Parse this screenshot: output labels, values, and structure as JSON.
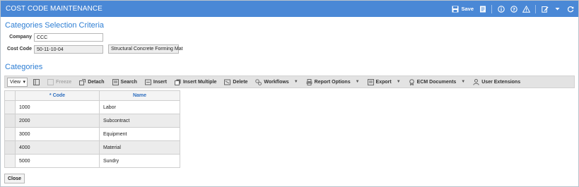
{
  "window": {
    "title": "COST CODE MAINTENANCE"
  },
  "titlebar": {
    "save_label": "Save",
    "icons": [
      "save-icon",
      "notes-icon",
      "info-icon",
      "help-icon",
      "warning-icon",
      "edit-icon",
      "refresh-icon"
    ]
  },
  "criteria": {
    "heading": "Categories Selection Criteria",
    "company_label": "Company",
    "company_value": "CCC",
    "cost_code_label": "Cost Code",
    "cost_code_value": "50-11-10-04",
    "cost_code_desc": "Structural Concrete Forming Mat"
  },
  "categories": {
    "heading": "Categories",
    "toolbar": {
      "view": "View",
      "freeze": "Freeze",
      "detach": "Detach",
      "search": "Search",
      "insert": "Insert",
      "insert_multiple": "Insert Multiple",
      "delete": "Delete",
      "workflows": "Workflows",
      "report_options": "Report Options",
      "export": "Export",
      "ecm_documents": "ECM Documents",
      "user_extensions": "User Extensions"
    },
    "columns": {
      "code": "* Code",
      "name": "Name"
    },
    "rows": [
      {
        "code": "1000",
        "name": "Labor"
      },
      {
        "code": "2000",
        "name": "Subcontract"
      },
      {
        "code": "3000",
        "name": "Equipment"
      },
      {
        "code": "4000",
        "name": "Material"
      },
      {
        "code": "5000",
        "name": "Sundry"
      }
    ]
  },
  "footer": {
    "close_label": "Close"
  },
  "colors": {
    "titlebar": "#4a88d6",
    "heading": "#2f7fd4",
    "column_header": "#2f6fbf"
  }
}
